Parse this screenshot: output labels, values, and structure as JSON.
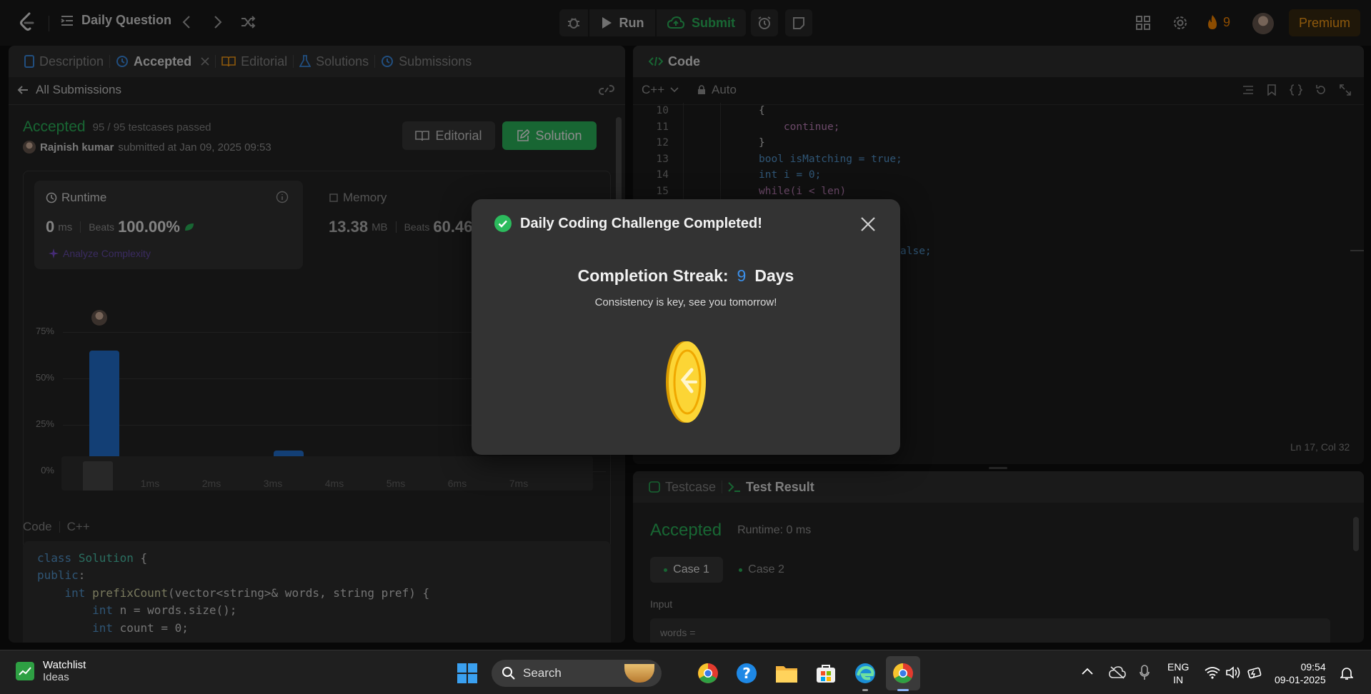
{
  "topbar": {
    "title": "Daily Question",
    "run_label": "Run",
    "submit_label": "Submit",
    "streak_count": "9",
    "premium_label": "Premium"
  },
  "left_tabs": [
    "Description",
    "Accepted",
    "Editorial",
    "Solutions",
    "Submissions"
  ],
  "submission": {
    "back_label": "All Submissions",
    "status": "Accepted",
    "testcases": "95 / 95 testcases passed",
    "user": "Rajnish kumar",
    "submitted_text": "submitted at Jan 09, 2025 09:53",
    "editorial_btn": "Editorial",
    "solution_btn": "Solution",
    "runtime_title": "Runtime",
    "runtime_value": "0",
    "runtime_unit": "ms",
    "beats_label": "Beats",
    "runtime_beats": "100.00%",
    "analyze_label": "Analyze Complexity",
    "memory_title": "Memory",
    "memory_value": "13.38",
    "memory_unit": "MB",
    "memory_beats": "60.46"
  },
  "chart_data": {
    "type": "bar",
    "categories": [
      "0ms",
      "1ms",
      "2ms",
      "3ms",
      "4ms",
      "5ms"
    ],
    "values": [
      65,
      3,
      3.5,
      11,
      5.5,
      2.5
    ],
    "yticks": [
      "75%",
      "50%",
      "25%",
      "0%"
    ],
    "xtick_labels": [
      "1ms",
      "2ms",
      "3ms",
      "4ms",
      "5ms"
    ],
    "ylim": [
      0,
      75
    ],
    "mini_ticks": [
      "1ms",
      "2ms",
      "3ms",
      "4ms",
      "5ms",
      "6ms",
      "7ms"
    ],
    "bar_color": "#2473d6"
  },
  "code_preview": {
    "title": "Code",
    "lang": "C++",
    "lines": [
      "class Solution {",
      "public:",
      "    int prefixCount(vector<string>& words, string pref) {",
      "        int n = words.size();",
      "        int count = 0;"
    ]
  },
  "editor": {
    "title": "Code",
    "lang": "C++",
    "mode": "Auto",
    "line_numbers": [
      "10",
      "11",
      "12",
      "13",
      "14",
      "15"
    ],
    "lines": [
      "{",
      "    continue;",
      "}",
      "bool isMatching = true;",
      "int i = 0;",
      "while(i < len)"
    ],
    "partial_text": "alse;",
    "cursor_pos": "Ln 17, Col 32"
  },
  "bottom_tabs": [
    "Testcase",
    "Test Result"
  ],
  "result": {
    "status": "Accepted",
    "runtime": "Runtime: 0 ms",
    "cases": [
      "Case 1",
      "Case 2"
    ],
    "input_label": "Input",
    "input_value": "words ="
  },
  "modal": {
    "title": "Daily Coding Challenge Completed!",
    "streak_prefix": "Completion Streak:",
    "streak_number": "9",
    "streak_suffix": "Days",
    "message": "Consistency is key, see you tomorrow!"
  },
  "taskbar": {
    "widget_title": "Watchlist",
    "widget_sub": "Ideas",
    "search_placeholder": "Search",
    "lang_top": "ENG",
    "lang_bottom": "IN",
    "time": "09:54",
    "date": "09-01-2025"
  },
  "colors": {
    "accepted_green": "#2cbb5d",
    "streak_blue": "#3c8fe8",
    "premium": "#ffa116",
    "fire": "#ff8a00"
  }
}
